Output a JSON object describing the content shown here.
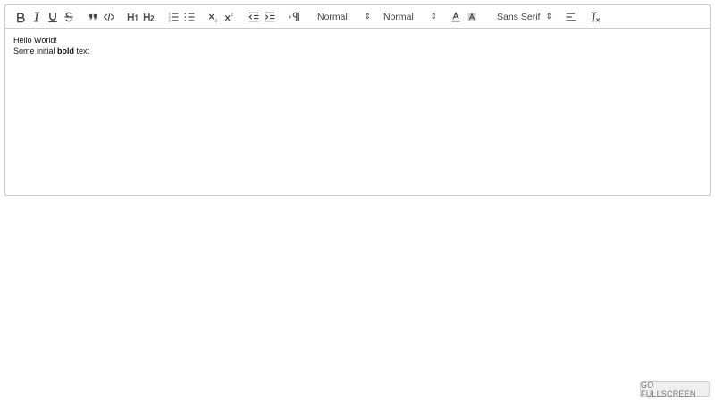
{
  "toolbar": {
    "buttons": [
      {
        "name": "bold-icon"
      },
      {
        "name": "italic-icon"
      },
      {
        "name": "underline-icon"
      },
      {
        "name": "strike-icon"
      },
      {
        "name": "blockquote-icon"
      },
      {
        "name": "code-block-icon"
      },
      {
        "name": "header1-icon"
      },
      {
        "name": "header2-icon"
      },
      {
        "name": "ordered-list-icon"
      },
      {
        "name": "bullet-list-icon"
      },
      {
        "name": "subscript-icon"
      },
      {
        "name": "superscript-icon"
      },
      {
        "name": "outdent-icon"
      },
      {
        "name": "indent-icon"
      },
      {
        "name": "direction-rtl-icon"
      },
      {
        "name": "text-color-icon"
      },
      {
        "name": "background-color-icon"
      },
      {
        "name": "align-icon"
      },
      {
        "name": "clean-format-icon"
      }
    ],
    "size_select": {
      "value": "Normal"
    },
    "header_select": {
      "value": "Normal"
    },
    "font_select": {
      "value": "Sans Serif"
    }
  },
  "content": {
    "line1": "Hello World!",
    "line2_before": "Some initial ",
    "line2_bold": "bold",
    "line2_after": " text"
  },
  "fullscreen_button": {
    "label": "GO FULLSCREEN"
  }
}
